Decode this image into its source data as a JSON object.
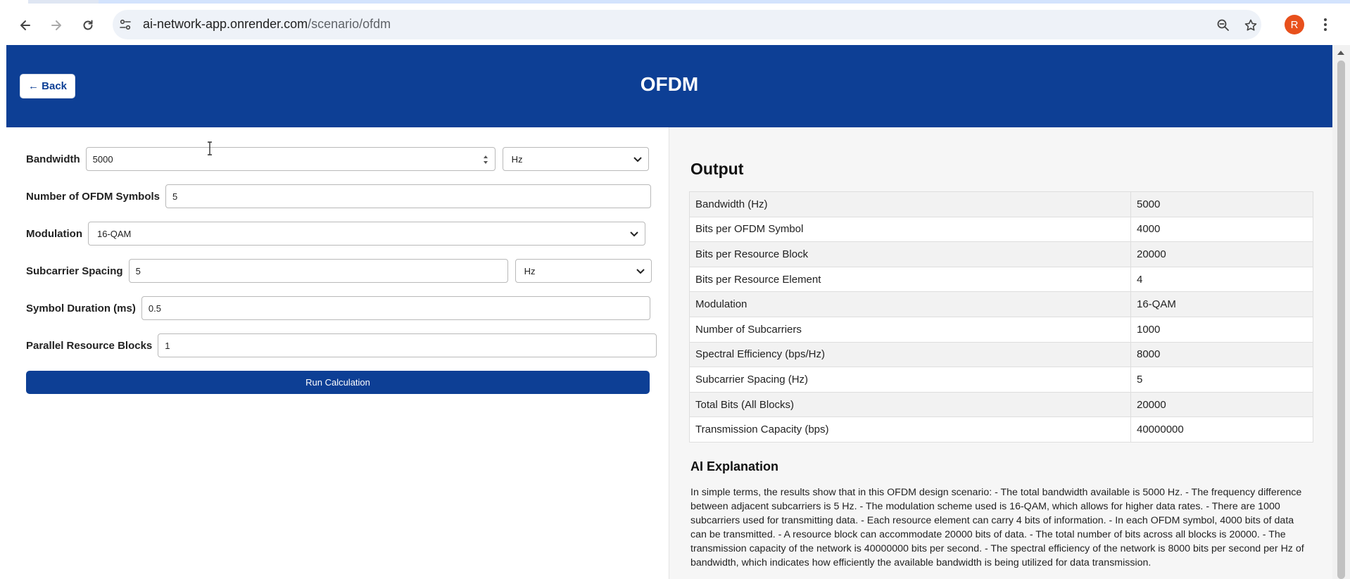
{
  "browser": {
    "url_host": "ai-network-app.onrender.com",
    "url_path": "/scenario/ofdm",
    "avatar_letter": "R",
    "avatar_color": "#e8501c"
  },
  "header": {
    "back_label": "← Back",
    "title": "OFDM",
    "bg_color": "#0d3f95"
  },
  "form": {
    "bandwidth_label": "Bandwidth",
    "bandwidth_value": "5000",
    "bandwidth_unit": "Hz",
    "symbols_label": "Number of OFDM Symbols",
    "symbols_value": "5",
    "modulation_label": "Modulation",
    "modulation_value": "16-QAM",
    "spacing_label": "Subcarrier Spacing",
    "spacing_value": "5",
    "spacing_unit": "Hz",
    "duration_label": "Symbol Duration (ms)",
    "duration_value": "0.5",
    "blocks_label": "Parallel Resource Blocks",
    "blocks_value": "1",
    "run_label": "Run Calculation"
  },
  "output": {
    "title": "Output",
    "rows": [
      {
        "key": "Bandwidth (Hz)",
        "value": "5000"
      },
      {
        "key": "Bits per OFDM Symbol",
        "value": "4000"
      },
      {
        "key": "Bits per Resource Block",
        "value": "20000"
      },
      {
        "key": "Bits per Resource Element",
        "value": "4"
      },
      {
        "key": "Modulation",
        "value": "16-QAM"
      },
      {
        "key": "Number of Subcarriers",
        "value": "1000"
      },
      {
        "key": "Spectral Efficiency (bps/Hz)",
        "value": "8000"
      },
      {
        "key": "Subcarrier Spacing (Hz)",
        "value": "5"
      },
      {
        "key": "Total Bits (All Blocks)",
        "value": "20000"
      },
      {
        "key": "Transmission Capacity (bps)",
        "value": "40000000"
      }
    ],
    "ai_title": "AI Explanation",
    "ai_text": "In simple terms, the results show that in this OFDM design scenario: - The total bandwidth available is 5000 Hz. - The frequency difference between adjacent subcarriers is 5 Hz. - The modulation scheme used is 16-QAM, which allows for higher data rates. - There are 1000 subcarriers used for transmitting data. - Each resource element can carry 4 bits of information. - In each OFDM symbol, 4000 bits of data can be transmitted. - A resource block can accommodate 20000 bits of data. - The total number of bits across all blocks is 20000. - The transmission capacity of the network is 40000000 bits per second. - The spectral efficiency of the network is 8000 bits per second per Hz of bandwidth, which indicates how efficiently the available bandwidth is being utilized for data transmission."
  }
}
